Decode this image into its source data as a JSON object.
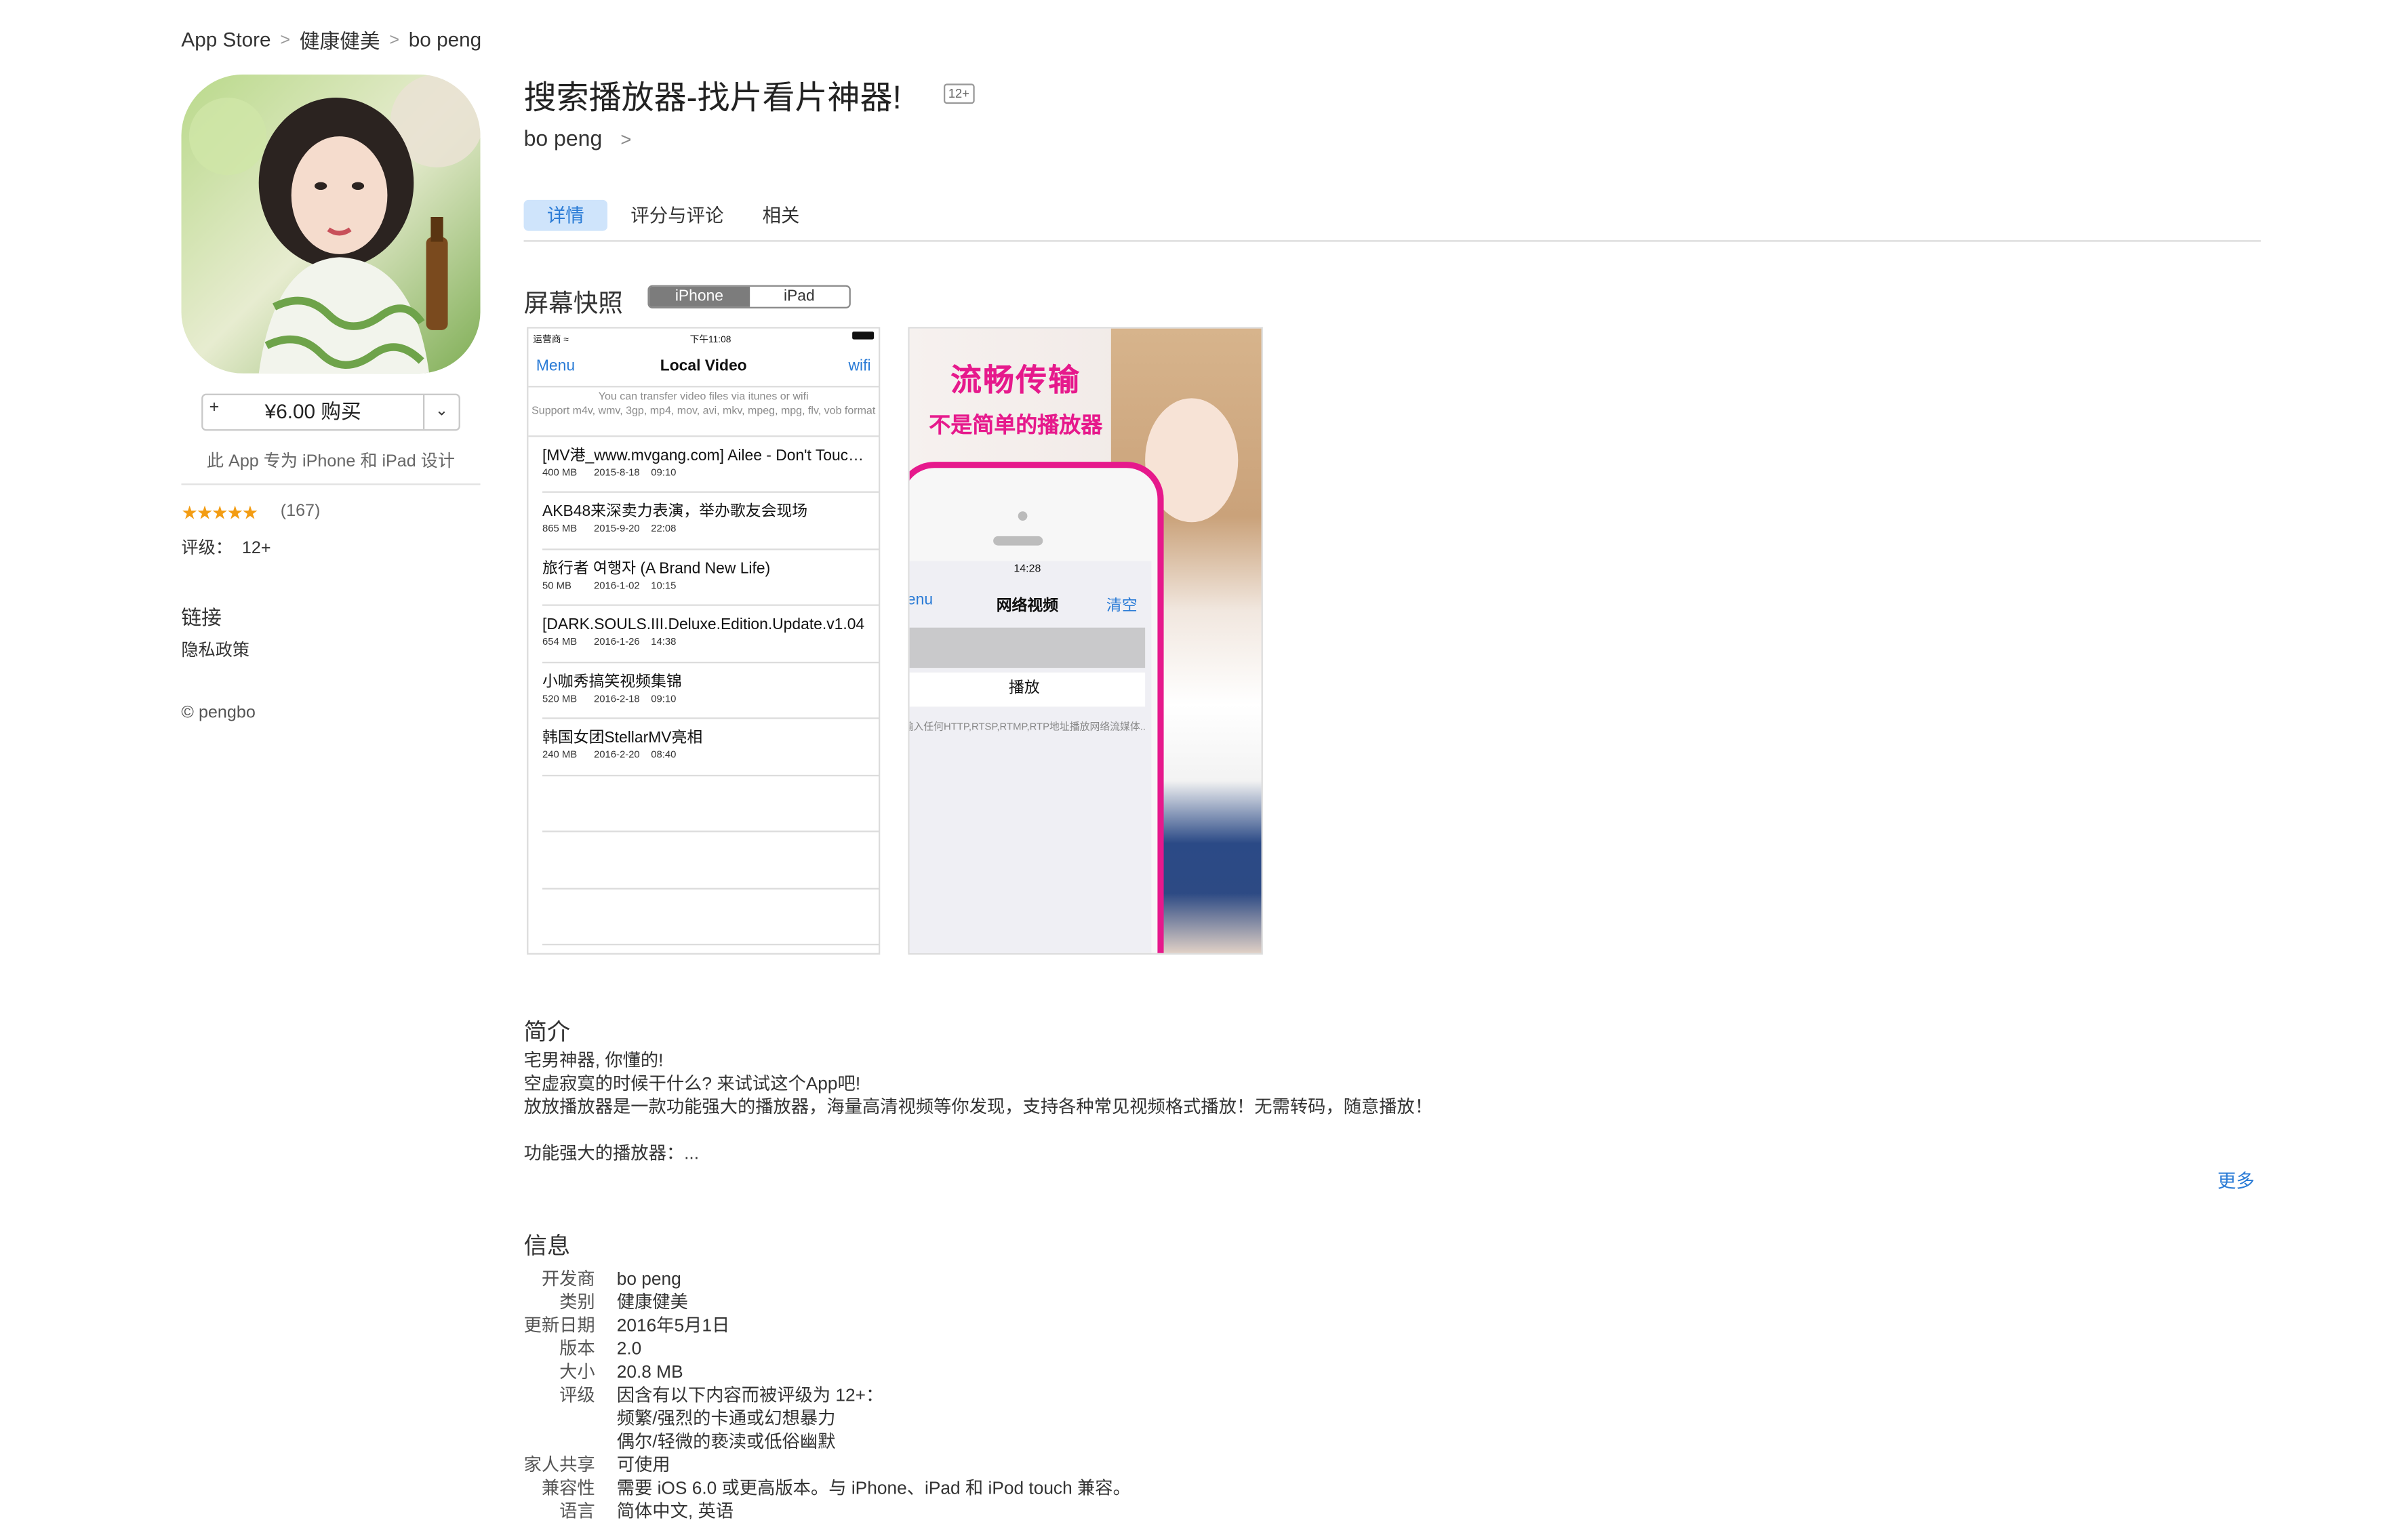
{
  "breadcrumb": {
    "store": "App Store",
    "category": "健康健美",
    "developer": "bo peng"
  },
  "sidebar": {
    "buy_label": "¥6.00 购买",
    "buy_plus": "+",
    "designed_for": "此 App 专为 iPhone 和 iPad 设计",
    "stars": "★★★★★",
    "rating_count": "(167)",
    "grade_label": "评级：",
    "grade_value": "12+",
    "links_heading": "链接",
    "privacy_link": "隐私政策",
    "copyright": "© pengbo"
  },
  "header": {
    "title": "搜索播放器-找片看片神器!",
    "age_badge": "12+",
    "developer_link": "bo peng",
    "tabs": [
      "详情",
      "评分与评论",
      "相关"
    ]
  },
  "screenshots": {
    "heading": "屏幕快照",
    "segments": [
      "iPhone",
      "iPad"
    ],
    "shot1": {
      "carrier": "运营商",
      "time": "下午11:08",
      "nav_left": "Menu",
      "nav_title": "Local Video",
      "nav_right": "wifi",
      "hint": "You can transfer video files via itunes or wifi\nSupport m4v, wmv, 3gp, mp4, mov, avi, mkv, mpeg, mpg, flv, vob format",
      "items": [
        {
          "title": "[MV港_www.mvgang.com] Ailee - Don't Touch Me",
          "meta": "400 MB      2015-8-18    09:10"
        },
        {
          "title": "AKB48来深卖力表演，举办歌友会现场",
          "meta": "865 MB      2015-9-20    22:08"
        },
        {
          "title": "旅行者 여행자 (A Brand New Life)",
          "meta": "50 MB        2016-1-02    10:15"
        },
        {
          "title": "[DARK.SOULS.III.Deluxe.Edition.Update.v1.04",
          "meta": "654 MB      2016-1-26    14:38"
        },
        {
          "title": "小咖秀搞笑视频集锦",
          "meta": "520 MB      2016-2-18    09:10"
        },
        {
          "title": "韩国女团StellarMV亮相",
          "meta": "240 MB      2016-2-20    08:40"
        }
      ]
    },
    "shot2": {
      "headline": "流畅传输",
      "subline": "不是简单的播放器",
      "time": "14:28",
      "nav_left": "Menu",
      "nav_title": "网络视频",
      "nav_right": "清空",
      "play": "播放",
      "hint": "输入任何HTTP,RTSP,RTMP,RTP地址播放网络流媒体..."
    }
  },
  "description": {
    "heading": "简介",
    "body": "宅男神器, 你懂的!\n空虚寂寞的时候干什么? 来试试这个App吧!\n放放播放器是一款功能强大的播放器，海量高清视频等你发现，支持各种常见视频格式播放！无需转码，随意播放！\n\n功能强大的播放器：...",
    "more": "更多"
  },
  "info": {
    "heading": "信息",
    "rows": [
      {
        "k": "开发商",
        "v": "bo peng"
      },
      {
        "k": "类别",
        "v": "健康健美"
      },
      {
        "k": "更新日期",
        "v": "2016年5月1日"
      },
      {
        "k": "版本",
        "v": "2.0"
      },
      {
        "k": "大小",
        "v": "20.8 MB"
      },
      {
        "k": "评级",
        "v": "因含有以下内容而被评级为 12+："
      },
      {
        "k": "",
        "v": "频繁/强烈的卡通或幻想暴力"
      },
      {
        "k": "",
        "v": "偶尔/轻微的亵渎或低俗幽默"
      },
      {
        "k": "家人共享",
        "v": "可使用"
      },
      {
        "k": "兼容性",
        "v": "需要 iOS 6.0 或更高版本。与 iPhone、iPad 和 iPod touch 兼容。"
      },
      {
        "k": "语言",
        "v": "简体中文, 英语"
      }
    ]
  },
  "colors": {
    "accent": "#2a7bd6",
    "tab_active_bg": "#cfe4fb",
    "stars": "#f39c12",
    "promo_pink": "#e6198c"
  }
}
